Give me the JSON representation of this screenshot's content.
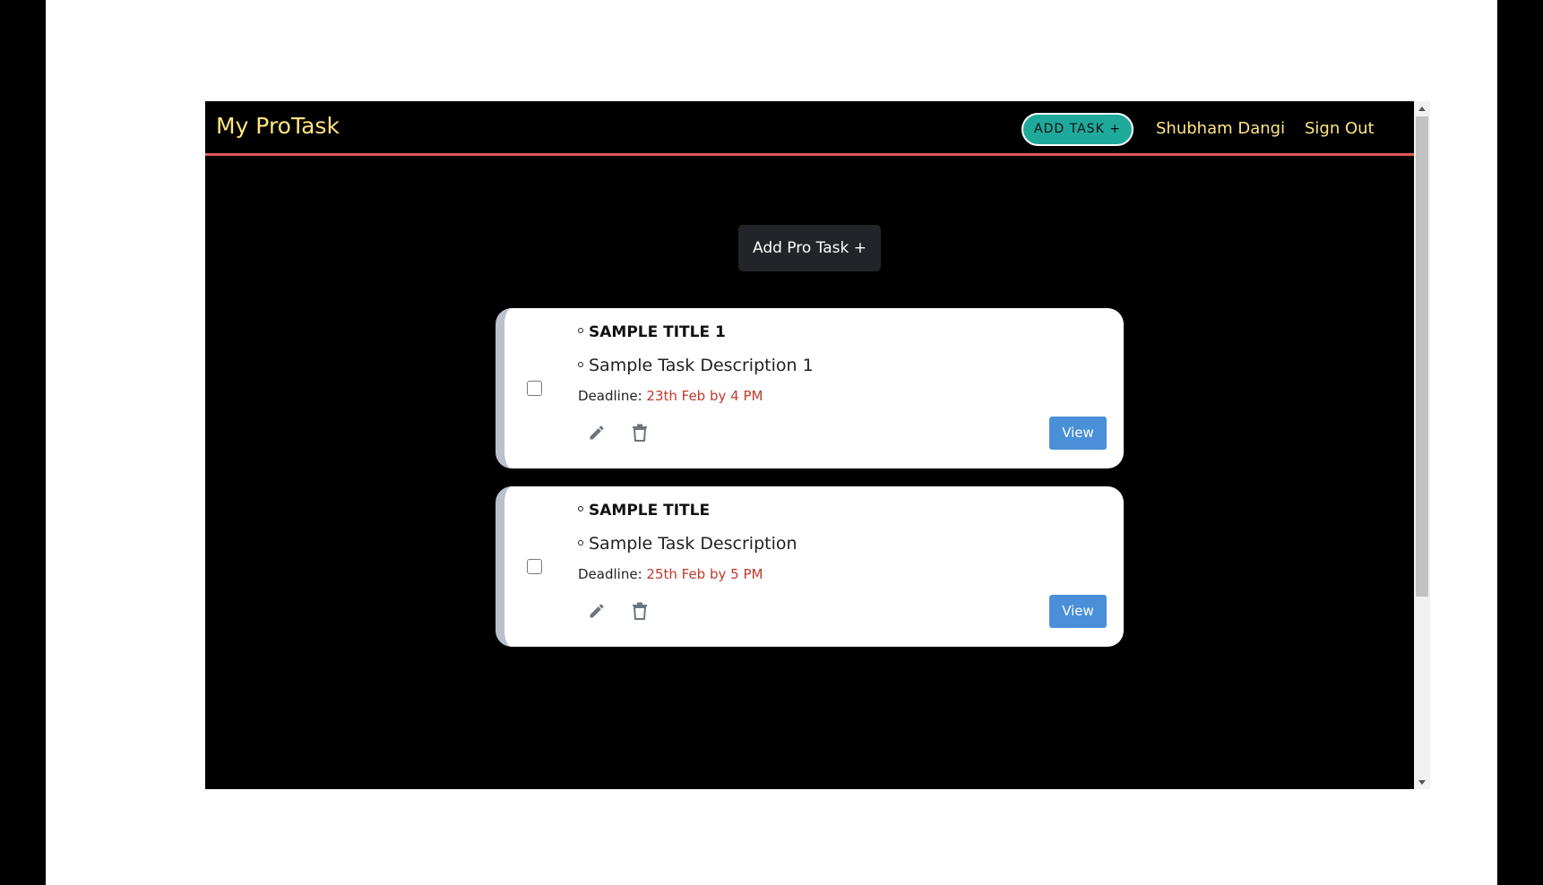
{
  "navbar": {
    "brand": "My ProTask",
    "add_task_label": "ADD TASK +",
    "user_name": "Shubham Dangi",
    "sign_out_label": "Sign Out"
  },
  "main": {
    "add_pro_task_label": "Add Pro Task +"
  },
  "tasks": [
    {
      "title": "SAMPLE TITLE 1",
      "description": "Sample Task Description 1",
      "deadline_label": "Deadline:",
      "deadline_value": "23th Feb by 4 PM",
      "view_label": "View",
      "checked": false
    },
    {
      "title": "SAMPLE TITLE",
      "description": "Sample Task Description",
      "deadline_label": "Deadline:",
      "deadline_value": "25th Feb by 5 PM",
      "view_label": "View",
      "checked": false
    }
  ],
  "colors": {
    "brand_text": "#ffe680",
    "navbar_border": "#e05a5a",
    "add_task_pill": "#1fa99b",
    "view_button": "#4a90d9",
    "deadline_value": "#c0392b"
  },
  "icons": {
    "edit": "pencil-icon",
    "delete": "trash-icon"
  }
}
